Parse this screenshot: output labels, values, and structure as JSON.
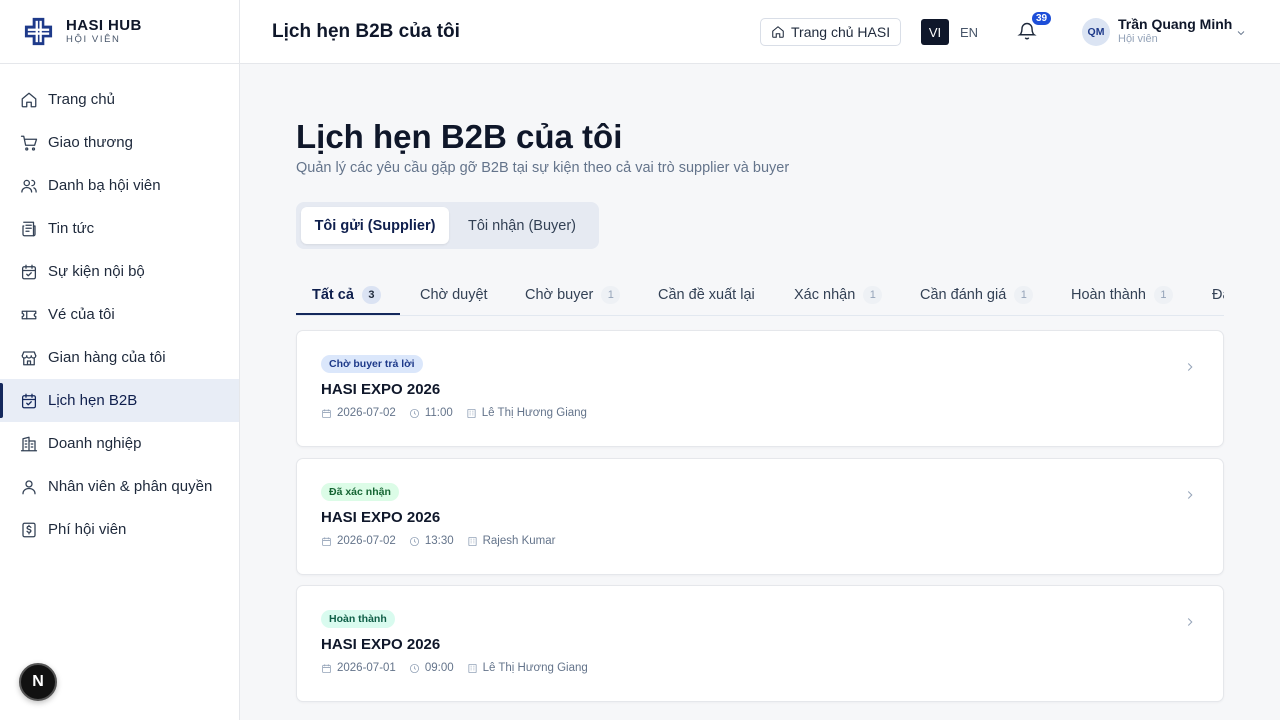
{
  "brand": {
    "name": "HASI HUB",
    "subtitle": "HỘI VIÊN"
  },
  "sidebar": {
    "items": [
      {
        "label": "Trang chủ",
        "icon": "home-icon"
      },
      {
        "label": "Giao thương",
        "icon": "cart-icon"
      },
      {
        "label": "Danh bạ hội viên",
        "icon": "users-icon"
      },
      {
        "label": "Tin tức",
        "icon": "newspaper-icon"
      },
      {
        "label": "Sự kiện nội bộ",
        "icon": "calendar-icon"
      },
      {
        "label": "Vé của tôi",
        "icon": "ticket-icon"
      },
      {
        "label": "Gian hàng của tôi",
        "icon": "store-icon"
      },
      {
        "label": "Lịch hẹn B2B",
        "icon": "calendar-check-icon",
        "active": true
      },
      {
        "label": "Doanh nghiệp",
        "icon": "building-icon"
      },
      {
        "label": "Nhân viên & phân quyền",
        "icon": "user-icon"
      },
      {
        "label": "Phí hội viên",
        "icon": "dollar-icon"
      }
    ],
    "floating_badge": "N"
  },
  "header": {
    "title": "Lịch hẹn B2B của tôi",
    "home_button": "Trang chủ HASI",
    "lang_vi": "VI",
    "lang_en": "EN",
    "notification_count": "39",
    "user": {
      "initials": "QM",
      "name": "Trần Quang Minh",
      "role": "Hội viên"
    }
  },
  "main": {
    "title": "Lịch hẹn B2B của tôi",
    "subtitle": "Quản lý các yêu cầu gặp gỡ B2B tại sự kiện theo cả vai trò supplier và buyer",
    "role_tabs": {
      "supplier": "Tôi gửi (Supplier)",
      "buyer": "Tôi nhận (Buyer)"
    },
    "status_tabs": [
      {
        "label": "Tất cả",
        "count": "3",
        "active": true
      },
      {
        "label": "Chờ duyệt",
        "count": ""
      },
      {
        "label": "Chờ buyer",
        "count": "1"
      },
      {
        "label": "Cần đề xuất lại",
        "count": ""
      },
      {
        "label": "Xác nhận",
        "count": "1"
      },
      {
        "label": "Cần đánh giá",
        "count": "1"
      },
      {
        "label": "Hoàn thành",
        "count": "1"
      },
      {
        "label": "Đã",
        "count": ""
      }
    ],
    "appointments": [
      {
        "status": "Chờ buyer trả lời",
        "status_color": "#dbe7fb",
        "event": "HASI EXPO 2026",
        "date": "2026-07-02",
        "time": "11:00",
        "partner": "Lê Thị Hương Giang"
      },
      {
        "status": "Đã xác nhận",
        "status_color": "#dcfce7",
        "event": "HASI EXPO 2026",
        "date": "2026-07-02",
        "time": "13:30",
        "partner": "Rajesh Kumar"
      },
      {
        "status": "Hoàn thành",
        "status_color": "#d9fbef",
        "event": "HASI EXPO 2026",
        "date": "2026-07-01",
        "time": "09:00",
        "partner": "Lê Thị Hương Giang"
      }
    ]
  },
  "colors": {
    "accent": "#14285c",
    "notification": "#1d4ed8"
  }
}
